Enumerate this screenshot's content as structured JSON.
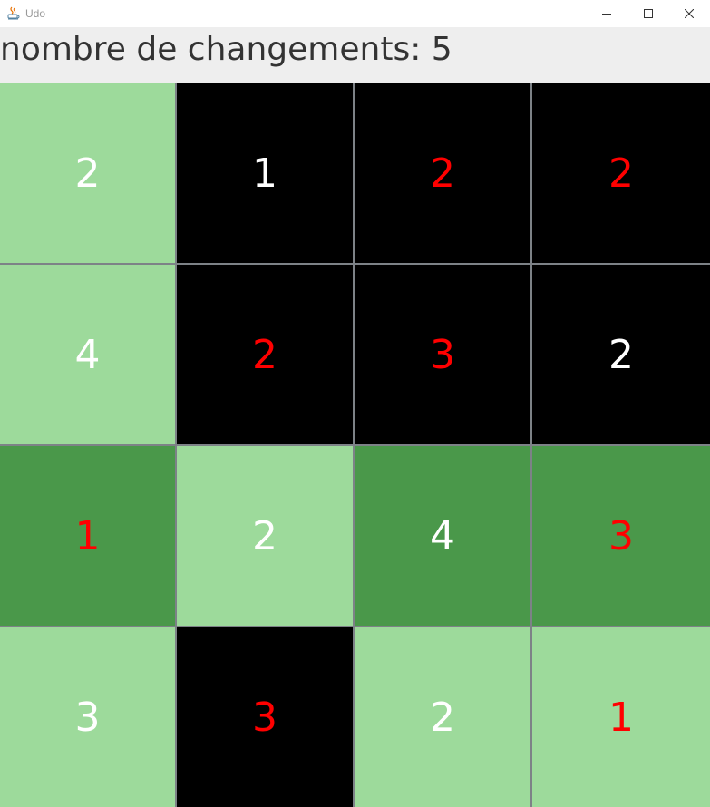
{
  "window": {
    "title": "Udo",
    "icon": "java-icon"
  },
  "header": {
    "counter_label": "nombre de changements: 5"
  },
  "colors": {
    "light_green": "#9dda9b",
    "dark_green": "#4a984a",
    "black": "#000000",
    "text_white": "#ffffff",
    "text_red": "#ff0000",
    "header_bg": "#eeeeee"
  },
  "grid": {
    "rows": 4,
    "cols": 4,
    "cells": [
      {
        "value": "2",
        "bg": "light_green",
        "text": "white"
      },
      {
        "value": "1",
        "bg": "black",
        "text": "white"
      },
      {
        "value": "2",
        "bg": "black",
        "text": "red"
      },
      {
        "value": "2",
        "bg": "black",
        "text": "red"
      },
      {
        "value": "4",
        "bg": "light_green",
        "text": "white"
      },
      {
        "value": "2",
        "bg": "black",
        "text": "red"
      },
      {
        "value": "3",
        "bg": "black",
        "text": "red"
      },
      {
        "value": "2",
        "bg": "black",
        "text": "white"
      },
      {
        "value": "1",
        "bg": "dark_green",
        "text": "red"
      },
      {
        "value": "2",
        "bg": "light_green",
        "text": "white"
      },
      {
        "value": "4",
        "bg": "dark_green",
        "text": "white"
      },
      {
        "value": "3",
        "bg": "dark_green",
        "text": "red"
      },
      {
        "value": "3",
        "bg": "light_green",
        "text": "white"
      },
      {
        "value": "3",
        "bg": "black",
        "text": "red"
      },
      {
        "value": "2",
        "bg": "light_green",
        "text": "white"
      },
      {
        "value": "1",
        "bg": "light_green",
        "text": "red"
      }
    ]
  }
}
